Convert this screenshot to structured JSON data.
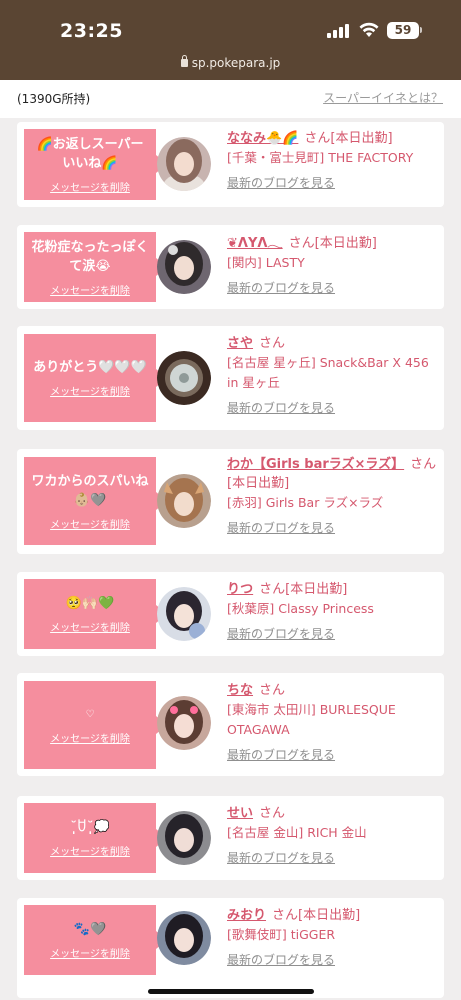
{
  "status": {
    "time": "23:25",
    "battery": "59",
    "url": "sp.pokepara.jp"
  },
  "header": {
    "points": "(1390G所持)",
    "super_link": "スーパーイイネとは？"
  },
  "colors": {
    "accent": "#f58e9e",
    "name": "#d5586e",
    "statusbar": "#5a4533"
  },
  "cards": [
    {
      "message": "🌈お返しスーパーいいね🌈",
      "delete": "メッセージを削除",
      "name": "ななみ🐣🌈",
      "san": "さん[本日出勤]",
      "shop": "[千葉・富士見町] THE FACTORY",
      "blog": "最新のブログを見る"
    },
    {
      "message": "花粉症なったっぽくて涙😭",
      "delete": "メッセージを削除",
      "name": "❦ΛYΛ𓂃",
      "san": "さん[本日出勤]",
      "shop": "[関内] LASTY",
      "blog": "最新のブログを見る"
    },
    {
      "message": "ありがとう🤍🤍🤍",
      "delete": "メッセージを削除",
      "name": "さや",
      "san": "さん",
      "shop": "[名古屋 星ヶ丘] Snack&Bar X 456 in 星ヶ丘",
      "blog": "最新のブログを見る"
    },
    {
      "message": "ワカからのスパいね👶🏼🩶",
      "delete": "メッセージを削除",
      "name": "わか【Girls barラズ×ラズ】",
      "san": "さん[本日出勤]",
      "shop": "[赤羽] Girls Bar ラズ×ラズ",
      "blog": "最新のブログを見る"
    },
    {
      "message": "🥺🙌🏻💚",
      "delete": "メッセージを削除",
      "name": "りつ",
      "san": "さん[本日出勤]",
      "shop": "[秋葉原] Classy Princess",
      "blog": "最新のブログを見る"
    },
    {
      "message": "♡",
      "delete": "メッセージを削除",
      "name": "ちな",
      "san": "さん",
      "shop": "[東海市 太田川] BURLESQUE OTAGAWA",
      "blog": "最新のブログを見る"
    },
    {
      "message": "˘̩̩̩ꇴ˘̩̩̩💭",
      "delete": "メッセージを削除",
      "name": "せい",
      "san": "さん",
      "shop": "[名古屋 金山] RICH 金山",
      "blog": "最新のブログを見る"
    },
    {
      "message": "🐾🩶",
      "delete": "メッセージを削除",
      "name": "みおり",
      "san": "さん[本日出勤]",
      "shop": "[歌舞伎町] tiGGER",
      "blog": "最新のブログを見る"
    }
  ]
}
